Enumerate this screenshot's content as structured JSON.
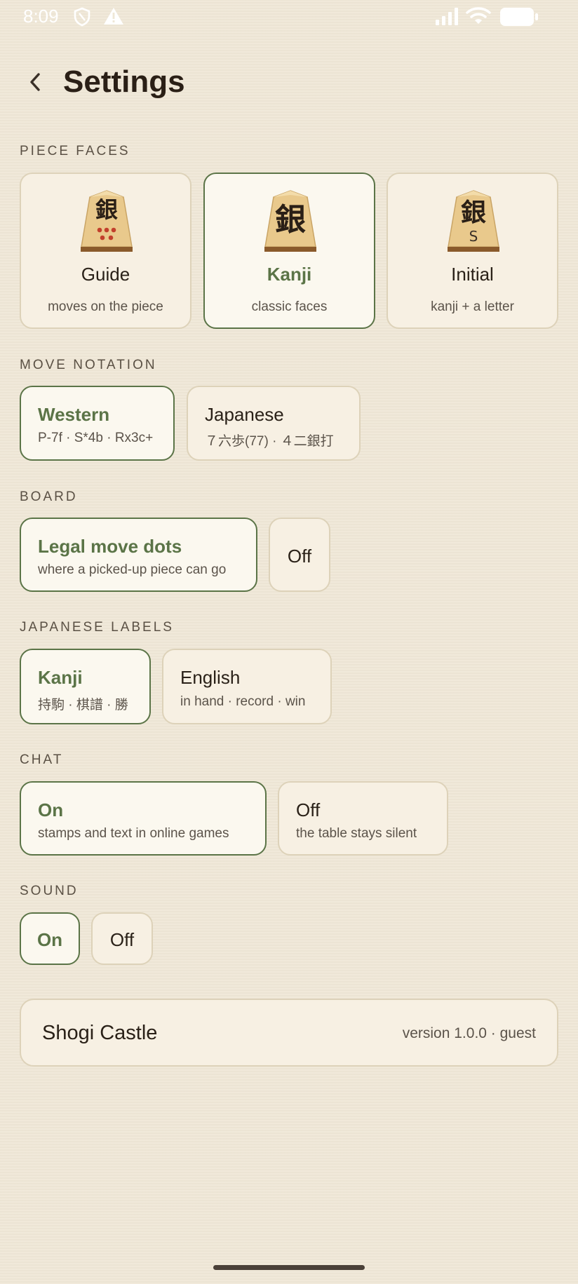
{
  "status_bar": {
    "time": "8:09",
    "icons": [
      "shield-icon",
      "warning-icon",
      "signal-icon",
      "wifi-icon",
      "battery-icon"
    ]
  },
  "header": {
    "title": "Settings",
    "back_icon": "chevron-left-icon"
  },
  "piece_faces": {
    "label": "PIECE FACES",
    "glyph": "銀",
    "options": [
      {
        "title": "Guide",
        "subtitle": "moves on the piece",
        "selected": false
      },
      {
        "title": "Kanji",
        "subtitle": "classic faces",
        "selected": true
      },
      {
        "title": "Initial",
        "subtitle": "kanji + a letter",
        "selected": false,
        "letter": "S"
      }
    ]
  },
  "move_notation": {
    "label": "MOVE NOTATION",
    "options": [
      {
        "title": "Western",
        "subtitle": "P-7f · S*4b · Rx3c+",
        "selected": true
      },
      {
        "title": "Japanese",
        "subtitle": "７六歩(77) · ４二銀打",
        "selected": false
      }
    ]
  },
  "board": {
    "label": "BOARD",
    "options": [
      {
        "title": "Legal move dots",
        "subtitle": "where a picked-up piece can go",
        "selected": true
      },
      {
        "title": "Off",
        "selected": false
      }
    ]
  },
  "japanese_labels": {
    "label": "JAPANESE LABELS",
    "options": [
      {
        "title": "Kanji",
        "subtitle": "持駒 · 棋譜 · 勝",
        "selected": true
      },
      {
        "title": "English",
        "subtitle": "in hand · record · win",
        "selected": false
      }
    ]
  },
  "chat": {
    "label": "CHAT",
    "options": [
      {
        "title": "On",
        "subtitle": "stamps and text in online games",
        "selected": true
      },
      {
        "title": "Off",
        "subtitle": "the table stays silent",
        "selected": false
      }
    ]
  },
  "sound": {
    "label": "SOUND",
    "options": [
      {
        "title": "On",
        "selected": true
      },
      {
        "title": "Off",
        "selected": false
      }
    ]
  },
  "footer": {
    "app_name": "Shogi Castle",
    "version": "version 1.0.0 · guest"
  },
  "colors": {
    "background": "#efe7d6",
    "accent": "#5b7447",
    "card": "#f7f0e3",
    "card_border": "#ddd2b9",
    "piece_wood": "#e9c98c",
    "guide_dots": "#c2402c"
  }
}
